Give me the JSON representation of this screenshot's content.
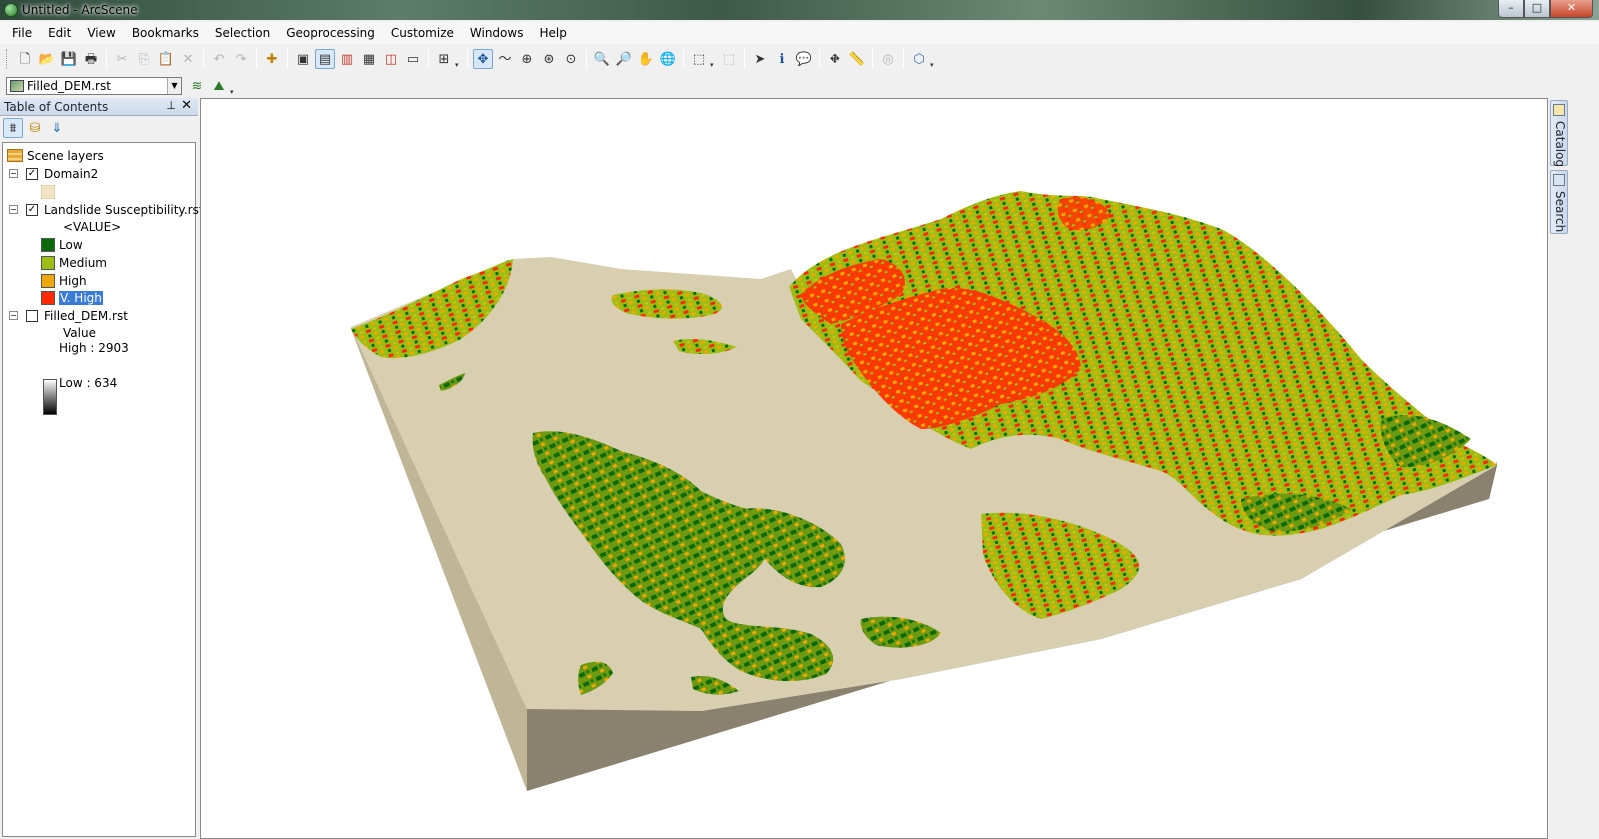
{
  "window": {
    "title": "Untitled - ArcScene",
    "controls": {
      "minimize": "–",
      "maximize": "□",
      "close": "✕"
    }
  },
  "menu": [
    "File",
    "Edit",
    "View",
    "Bookmarks",
    "Selection",
    "Geoprocessing",
    "Customize",
    "Windows",
    "Help"
  ],
  "toolbar": {
    "layer_combo": "Filled_DEM.rst"
  },
  "toc": {
    "title": "Table of Contents",
    "pin": "⊥",
    "close": "✕",
    "scene_layers": "Scene layers",
    "layers": [
      {
        "name": "Domain2",
        "checked": true,
        "expander": "−"
      },
      {
        "name": "Landslide Susceptibility.rst",
        "checked": true,
        "expander": "−",
        "field": "<VALUE>",
        "classes": [
          {
            "label": "Low",
            "color": "#0a6a0a"
          },
          {
            "label": "Medium",
            "color": "#9bbd14"
          },
          {
            "label": "High",
            "color": "#f0a800"
          },
          {
            "label": "V. High",
            "color": "#ff2a00"
          }
        ]
      },
      {
        "name": "Filled_DEM.rst",
        "checked": false,
        "expander": "−",
        "field": "Value",
        "high": "High : 2903",
        "low": "Low : 634"
      }
    ],
    "domain_swatch": "#f2e4c2"
  },
  "dock": {
    "catalog": "Catalog",
    "search": "Search"
  },
  "colors": {
    "terrain_flat": "#d8ceb0",
    "terrain_side": "#8a826e",
    "low": "#0a6a0a",
    "medium": "#9bbd14",
    "high": "#f0a800",
    "very_high": "#ff2a00"
  }
}
